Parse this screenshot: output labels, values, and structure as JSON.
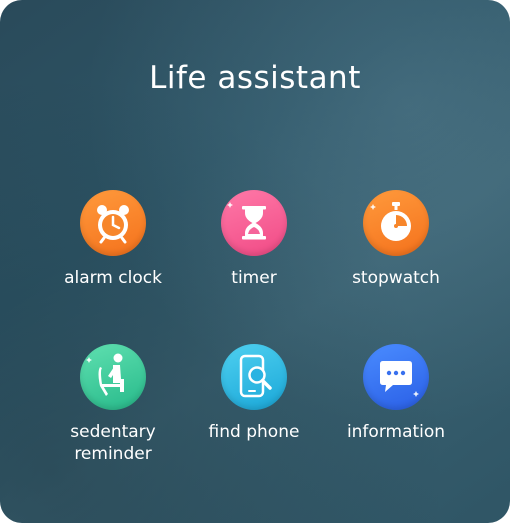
{
  "title": "Life assistant",
  "apps": [
    {
      "label": "alarm clock",
      "icon": "alarm-clock-icon",
      "color": "#f57a22"
    },
    {
      "label": "timer",
      "icon": "hourglass-icon",
      "color": "#f2568f"
    },
    {
      "label": "stopwatch",
      "icon": "stopwatch-icon",
      "color": "#f57a22"
    },
    {
      "label": "sedentary reminder",
      "icon": "person-seated-icon",
      "color": "#30c193"
    },
    {
      "label": "find phone",
      "icon": "phone-search-icon",
      "color": "#22aede"
    },
    {
      "label": "information",
      "icon": "message-bubble-icon",
      "color": "#2f66ea"
    }
  ]
}
